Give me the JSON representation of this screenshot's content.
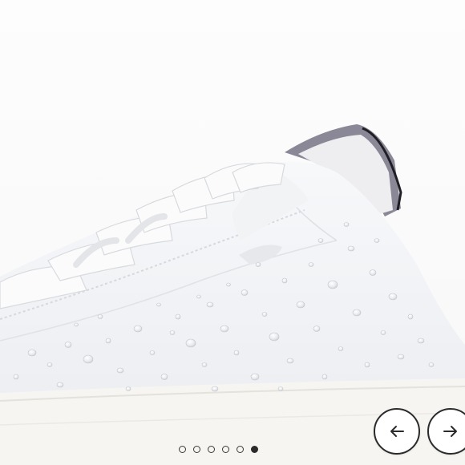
{
  "gallery": {
    "image_subject": "white-sneaker-with-water-droplets",
    "slide_count": 6,
    "active_slide": 6,
    "prev_icon": "arrow-left-icon",
    "next_icon": "arrow-right-icon",
    "colors": {
      "shoe_white": "#f3f4f6",
      "accent_gray": "#8a8796",
      "sole": "#f7f6f2",
      "button_border": "#2b2b2b"
    }
  }
}
